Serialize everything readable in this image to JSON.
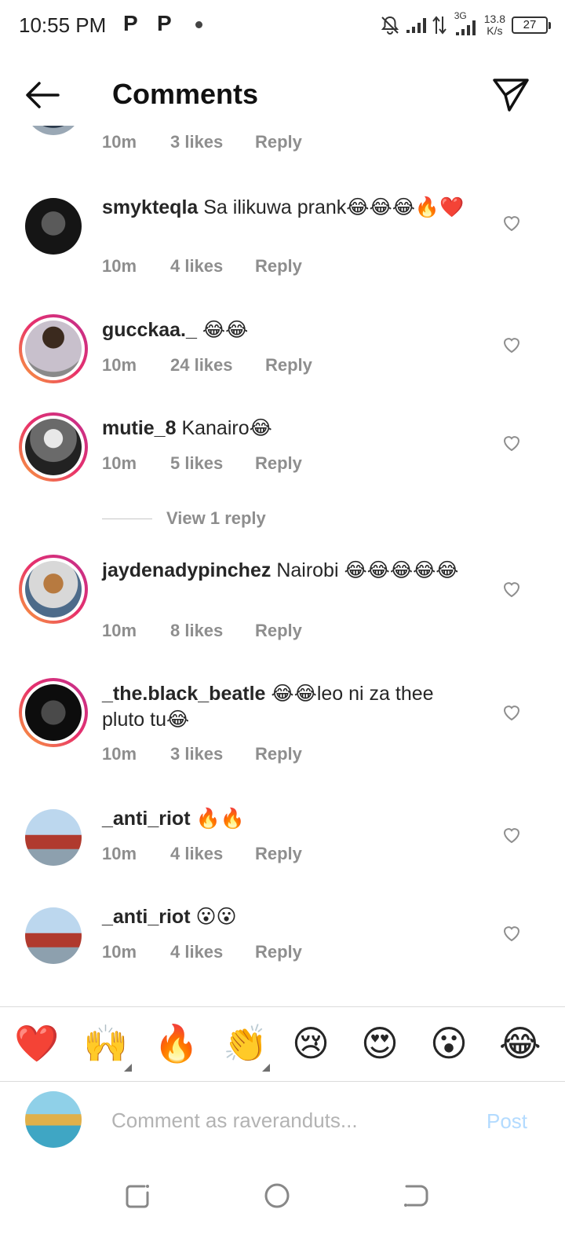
{
  "status_bar": {
    "time": "10:55 PM",
    "p1": "P",
    "p2": "P",
    "network": "3G",
    "speed_value": "13.8",
    "speed_unit": "K/s",
    "battery": "27"
  },
  "header": {
    "title": "Comments",
    "back_icon": "arrow-left-icon",
    "send_icon": "paper-plane-icon"
  },
  "comments": [
    {
      "user": "",
      "text": "",
      "time": "10m",
      "likes": "3 likes",
      "reply": "Reply"
    },
    {
      "user": "smykteqla",
      "text": "Sa ilikuwa prank😂😂😂🔥❤️",
      "time": "10m",
      "likes": "4 likes",
      "reply": "Reply"
    },
    {
      "user": "gucckaa._",
      "text": "😂😂",
      "time": "10m",
      "likes": "24 likes",
      "reply": "Reply"
    },
    {
      "user": "mutie_8",
      "text": "Kanairo😂",
      "time": "10m",
      "likes": "5 likes",
      "reply": "Reply"
    },
    {
      "user": "jaydenadypinchez",
      "text": "Nairobi 😂😂😂😂😂",
      "time": "10m",
      "likes": "8 likes",
      "reply": "Reply"
    },
    {
      "user": "_the.black_beatle",
      "text": "😂😂leo ni za thee pluto tu😂",
      "time": "10m",
      "likes": "3 likes",
      "reply": "Reply"
    },
    {
      "user": "_anti_riot",
      "text": "🔥🔥",
      "time": "10m",
      "likes": "4 likes",
      "reply": "Reply"
    },
    {
      "user": "_anti_riot",
      "text": "😮😮",
      "time": "10m",
      "likes": "4 likes",
      "reply": "Reply"
    }
  ],
  "view_reply": "View 1 reply",
  "quick_emojis": [
    "❤️",
    "🙌",
    "🔥",
    "👏",
    "😢",
    "😍",
    "😮",
    "😂"
  ],
  "composer": {
    "placeholder": "Comment as raveranduts...",
    "post_label": "Post"
  },
  "colors": {
    "link_disabled": "#b3dbff",
    "meta": "#8e8e8e",
    "story_ring_start": "#f9a33a",
    "story_ring_end": "#c02f8f"
  }
}
